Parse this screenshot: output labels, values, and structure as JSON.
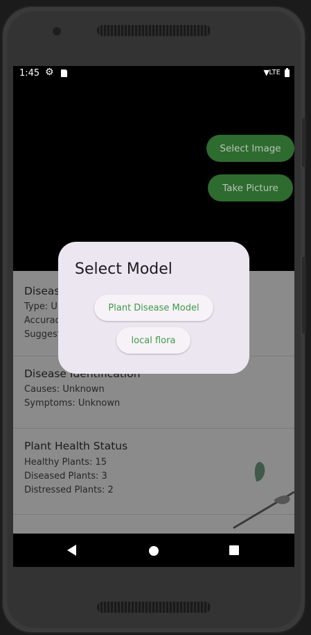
{
  "status_bar": {
    "time": "1:45",
    "network": "LTE"
  },
  "actions": {
    "select_image": "Select Image",
    "take_picture": "Take Picture"
  },
  "cards": [
    {
      "title": "Diseas",
      "lines": [
        "Type: Ur",
        "Accurac",
        "Suggest"
      ]
    },
    {
      "title": "Disease Identification",
      "lines": [
        "Causes: Unknown",
        "Symptoms: Unknown"
      ]
    },
    {
      "title": "Plant Health Status",
      "lines": [
        "Healthy Plants: 15",
        "Diseased Plants: 3",
        "Distressed Plants: 2"
      ]
    }
  ],
  "dialog": {
    "title": "Select Model",
    "options": [
      "Plant Disease Model",
      "local flora"
    ]
  },
  "colors": {
    "accent_green": "#2e6b2f",
    "dialog_bg": "#ece6f0",
    "option_text": "#3f9a4c"
  }
}
